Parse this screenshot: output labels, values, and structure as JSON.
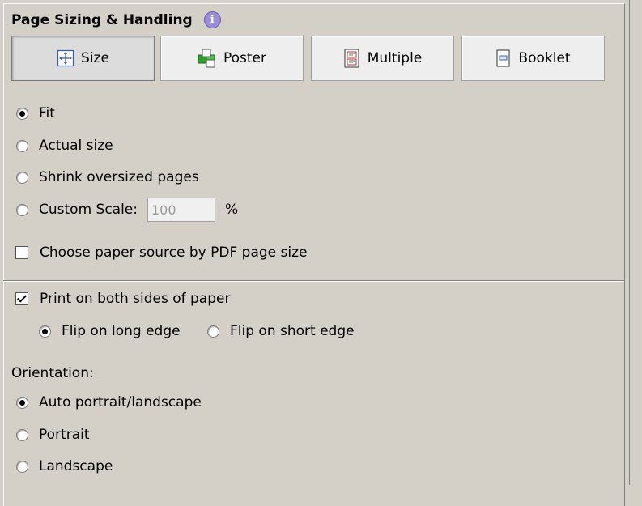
{
  "section": {
    "title": "Page Sizing & Handling",
    "info_icon": "info-icon"
  },
  "tabs": [
    {
      "label": "Size",
      "icon": "size-icon",
      "active": true
    },
    {
      "label": "Poster",
      "icon": "poster-icon",
      "active": false
    },
    {
      "label": "Multiple",
      "icon": "multiple-icon",
      "active": false
    },
    {
      "label": "Booklet",
      "icon": "booklet-icon",
      "active": false
    }
  ],
  "sizing": {
    "fit": "Fit",
    "actual_size": "Actual size",
    "shrink": "Shrink oversized pages",
    "custom_scale": "Custom Scale:",
    "custom_scale_value": "100",
    "percent": "%",
    "paper_source": "Choose paper source by PDF page size",
    "selected": "fit"
  },
  "duplex": {
    "label": "Print on both sides of paper",
    "checked": true,
    "long_edge": "Flip on long edge",
    "short_edge": "Flip on short edge",
    "selected": "long_edge"
  },
  "orientation": {
    "label": "Orientation:",
    "auto": "Auto portrait/landscape",
    "portrait": "Portrait",
    "landscape": "Landscape",
    "selected": "auto"
  },
  "colors": {
    "background": "#d4d0c8",
    "info_icon": "#9b8ed6"
  }
}
